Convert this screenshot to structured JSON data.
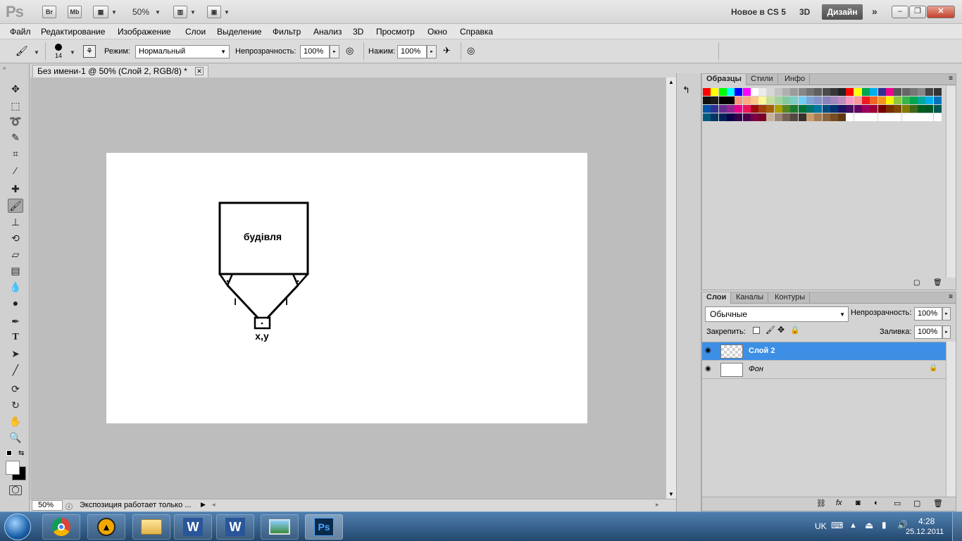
{
  "app_bar": {
    "br": "Br",
    "mb": "Mb",
    "zoom": "50%",
    "workspace_new": "Новое в CS 5",
    "workspace_3d": "3D",
    "workspace_active": "Дизайн"
  },
  "menu": [
    "Файл",
    "Редактирование",
    "Изображение",
    "Слои",
    "Выделение",
    "Фильтр",
    "Анализ",
    "3D",
    "Просмотр",
    "Окно",
    "Справка"
  ],
  "options": {
    "brush_size": "14",
    "mode_label": "Режим:",
    "mode_value": "Нормальный",
    "opacity_label": "Непрозрачность:",
    "opacity_value": "100%",
    "pressure_label": "Нажим:",
    "pressure_value": "100%"
  },
  "document": {
    "tab_title": "Без имени-1 @ 50% (Слой 2, RGB/8) *",
    "zoom": "50%",
    "status": "Экспозиция работает только ...",
    "drawing": {
      "box_label": "будівля",
      "leg_left": "l",
      "leg_right": "l",
      "point_label": "x,y"
    }
  },
  "swatch_panel": {
    "tabs": [
      "Образцы",
      "Стили",
      "Инфо"
    ],
    "rows": [
      [
        "#ff0000",
        "#ffff00",
        "#00ff00",
        "#00ffff",
        "#0000ff",
        "#ff00ff",
        "#ffffff",
        "#ebebeb",
        "#d7d7d7",
        "#c3c3c3",
        "#afafaf",
        "#9b9b9b",
        "#878787",
        "#737373",
        "#5f5f5f",
        "#4b4b4b",
        "#373737",
        "#232323",
        "#ff0000",
        "#ffff00",
        "#00a651",
        "#00aeef",
        "#2e3192",
        "#ec008c",
        "#555555",
        "#666666",
        "#777777",
        "#888888",
        "#444444",
        "#333333"
      ],
      [
        "#0f0f0f",
        "#1a1a1a",
        "#000000",
        "#000000",
        "#f7977a",
        "#f9ad81",
        "#fdc68a",
        "#fff79a",
        "#c4df9b",
        "#a3d39c",
        "#82ca9d",
        "#7bcdc8",
        "#6ecff6",
        "#7ea7d8",
        "#8493ca",
        "#8882be",
        "#a187be",
        "#bc8dbf",
        "#f49ac2",
        "#f6989d",
        "#ed1c24",
        "#f26522",
        "#f7941d",
        "#fff200",
        "#8dc73f",
        "#39b54a",
        "#00a651",
        "#00a99d",
        "#00aeef",
        "#0072bc"
      ],
      [
        "#0054a6",
        "#2e3192",
        "#662d91",
        "#92278f",
        "#ec008c",
        "#ed145b",
        "#9e0b0f",
        "#a0410d",
        "#a36209",
        "#aba000",
        "#598527",
        "#1a7b30",
        "#007236",
        "#00746b",
        "#0076a3",
        "#004b80",
        "#003471",
        "#1b1464",
        "#440e62",
        "#630460",
        "#9e005d",
        "#9e0039",
        "#790000",
        "#7b2e00",
        "#7d4900",
        "#827b00",
        "#406618",
        "#005e20",
        "#005826",
        "#005952"
      ],
      [
        "#005b7f",
        "#003663",
        "#002157",
        "#0d004c",
        "#32004b",
        "#4b0049",
        "#7b0046",
        "#7a0026",
        "#c7b299",
        "#998675",
        "#736357",
        "#534741",
        "#37302d",
        "#c69c6d",
        "#a67c52",
        "#8c6239",
        "#754c24",
        "#603913",
        "#fff",
        "#fff",
        "#fff",
        "#fff",
        "#fff",
        "#fff",
        "#fff",
        "#fff",
        "#fff",
        "#fff",
        "#fff",
        "#fff"
      ]
    ]
  },
  "layers_panel": {
    "tabs": [
      "Слои",
      "Каналы",
      "Контуры"
    ],
    "blend_mode": "Обычные",
    "opacity_label": "Непрозрачность:",
    "opacity_value": "100%",
    "lock_label": "Закрепить:",
    "fill_label": "Заливка:",
    "fill_value": "100%",
    "layers": [
      {
        "name": "Слой 2",
        "selected": true
      },
      {
        "name": "Фон",
        "selected": false
      }
    ]
  },
  "taskbar": {
    "lang": "UK",
    "time": "4:28",
    "date": "25.12.2011"
  },
  "colors": {
    "selection_blue": "#3d8fe6",
    "taskbar": "#2b527f"
  }
}
